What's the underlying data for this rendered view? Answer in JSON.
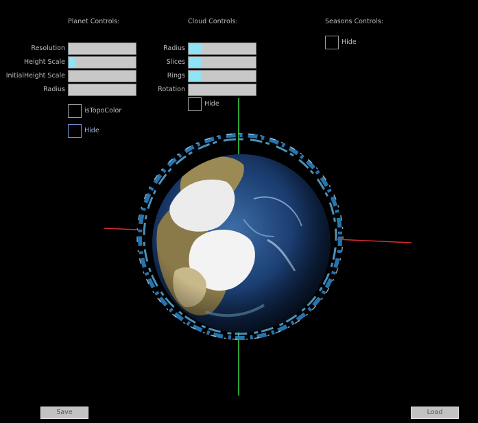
{
  "planet_controls": {
    "header": "Planet Controls:",
    "sliders": [
      {
        "label": "Resolution",
        "fill": 0.02
      },
      {
        "label": "Height Scale",
        "fill": 0.1
      },
      {
        "label": "InitialHeight Scale",
        "fill": 0.0
      },
      {
        "label": "Radius",
        "fill": 0.0
      }
    ],
    "is_topo_color_label": "isTopoColor",
    "hide_label": "Hide"
  },
  "cloud_controls": {
    "header": "Cloud Controls:",
    "sliders": [
      {
        "label": "Radius",
        "fill": 0.19
      },
      {
        "label": "Slices",
        "fill": 0.18
      },
      {
        "label": "Rings",
        "fill": 0.18
      },
      {
        "label": "Rotation",
        "fill": 0.0
      }
    ],
    "hide_label": "Hide"
  },
  "seasons_controls": {
    "header": "Seasons Controls:",
    "hide_label": "Hide"
  },
  "buttons": {
    "save_label": "Save",
    "load_label": "Load"
  },
  "colors": {
    "slider_fill": "#8ee3f4",
    "axis_green": "#3fd94a",
    "axis_red": "#d92b2b"
  }
}
